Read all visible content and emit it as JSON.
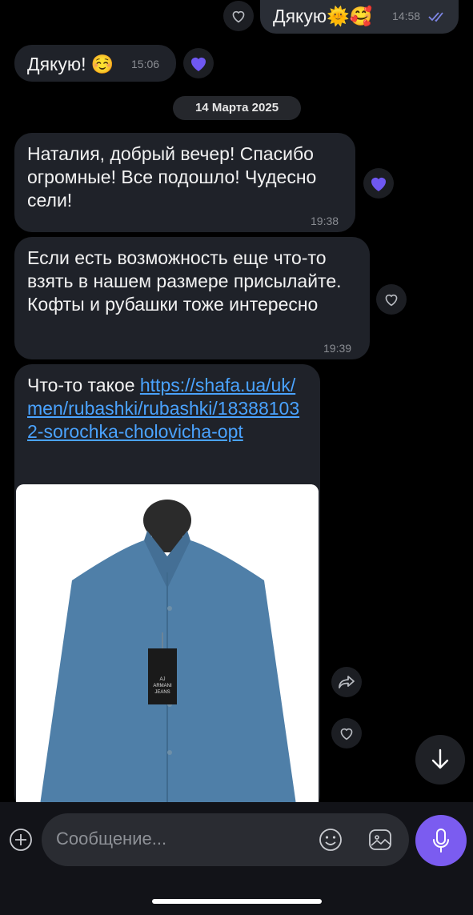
{
  "messages": {
    "m1": {
      "text": "Дякую🌞🥰",
      "time": "14:58"
    },
    "m2": {
      "text": "Дякую! ☺️",
      "time": "15:06"
    },
    "date": "14 Марта 2025",
    "m3": {
      "text": "Наталия, добрый вечер! Спасибо огромные! Все подошло! Чудесно сели!",
      "time": "19:38"
    },
    "m4": {
      "text": "Если есть возможность еще что-то взять в нашем размере присылайте. Кофты и рубашки тоже интересно",
      "time": "19:39"
    },
    "m5": {
      "prefix": "Что-то такое ",
      "link": "https://shafa.ua/uk/men/rubashki/rubashki/183881032-sorochka-cholovicha-opt"
    }
  },
  "photo": {
    "tag_brand": "AJ ARMANI JEANS"
  },
  "composer": {
    "placeholder": "Сообщение..."
  },
  "colors": {
    "accent": "#7b5cf0",
    "link": "#4aa3ff",
    "reaction": "#6f58f2"
  }
}
